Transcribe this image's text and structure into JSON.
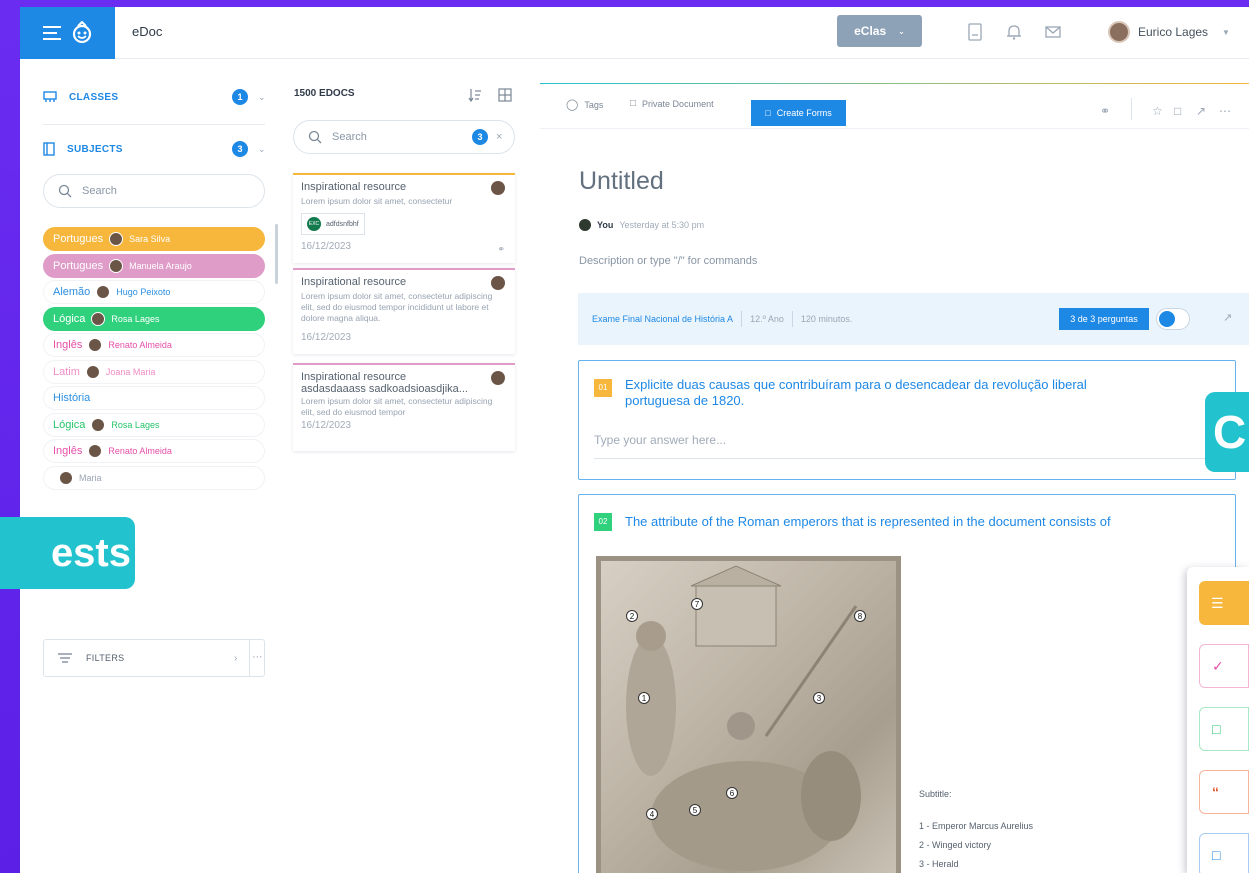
{
  "header": {
    "app_name": "eDoc",
    "env_button": "eClas",
    "user_name": "Eurico Lages"
  },
  "sidebar": {
    "classes_label": "CLASSES",
    "classes_count": "1",
    "subjects_label": "SUBJECTS",
    "subjects_count": "3",
    "search_placeholder": "Search",
    "subjects": [
      {
        "name": "Portugues",
        "teacher": "Sara Silva",
        "bg": "#f6b73c",
        "fg": "#ffffff",
        "tfg": "#ffffff"
      },
      {
        "name": "Portugues",
        "teacher": "Manuela Araujo",
        "bg": "#df9cc8",
        "fg": "#ffffff",
        "tfg": "#ffffff"
      },
      {
        "name": "Alemão",
        "teacher": "Hugo Peixoto",
        "bg": "#ffffff",
        "fg": "#2b8fe2",
        "tfg": "#2b8fe2"
      },
      {
        "name": "Lógica",
        "teacher": "Rosa Lages",
        "bg": "#2fd17d",
        "fg": "#ffffff",
        "tfg": "#ffffff"
      },
      {
        "name": "Inglês",
        "teacher": "Renato Almeida",
        "bg": "#ffffff",
        "fg": "#e64fa8",
        "tfg": "#e64fa8"
      },
      {
        "name": "Latim",
        "teacher": "Joana Maria",
        "bg": "#ffffff",
        "fg": "#f08cc4",
        "tfg": "#f08cc4"
      },
      {
        "name": "História",
        "teacher": "",
        "bg": "#ffffff",
        "fg": "#2b8fe2",
        "tfg": "#2b8fe2"
      },
      {
        "name": "Lógica",
        "teacher": "Rosa Lages",
        "bg": "#ffffff",
        "fg": "#27c46a",
        "tfg": "#27c46a"
      },
      {
        "name": "Inglês",
        "teacher": "Renato Almeida",
        "bg": "#ffffff",
        "fg": "#e64fa8",
        "tfg": "#e64fa8"
      },
      {
        "name": "",
        "teacher": "Maria",
        "bg": "#ffffff",
        "fg": "#9aa6b4",
        "tfg": "#9aa6b4"
      }
    ],
    "filters_label": "FILTERS"
  },
  "overlay": {
    "tests_text": "ests",
    "right_letter": "C"
  },
  "docs": {
    "title": "1500 EDOCS",
    "search_placeholder": "Search",
    "search_count": "3",
    "cards": [
      {
        "title": "Inspirational resource",
        "body": "Lorem ipsum dolor sit amet, consectetur",
        "tag": "adfdsnfbhf",
        "tag_initials": "EXC",
        "date": "16/12/2023",
        "accent": "#f6b73c"
      },
      {
        "title": "Inspirational resource",
        "body": "Lorem ipsum dolor sit amet, consectetur adipiscing elit, sed do eiusmod tempor incididunt ut labore et dolore magna aliqua.",
        "date": "16/12/2023",
        "accent": "#df9cc8"
      },
      {
        "title": "Inspirational resource",
        "subtitle": "asdasdaaass sadkoadsioasdjika...",
        "body": "Lorem ipsum dolor sit amet, consectetur adipiscing elit, sed do eiusmod tempor",
        "date": "16/12/2023",
        "accent": "#df9cc8"
      }
    ]
  },
  "editor": {
    "toolbar": {
      "tags": "Tags",
      "private": "Private Document",
      "create_forms": "Create Forms"
    },
    "title": "Untitled",
    "author": "You",
    "timestamp": "Yesterday at 5:30 pm",
    "description_placeholder": "Description or type \"/\" for commands",
    "exam": {
      "name": "Exame Final Nacional de História A",
      "year": "12.º Ano",
      "duration": "120 minutos.",
      "questions": "3 de 3 perguntas"
    },
    "questions": [
      {
        "num": "01",
        "text": "Explicite duas causas que contribuíram para o desencadear da revolução liberal portuguesa de 1820.",
        "answer_placeholder": "Type your answer here..."
      },
      {
        "num": "02",
        "text": "The attribute of the Roman emperors that is represented in the document consists of"
      }
    ],
    "legend": {
      "subtitle": "Subtitle:",
      "items": [
        "1 - Emperor Marcus Aurelius",
        "2 - Winged victory",
        "3 - Herald"
      ]
    },
    "markers": [
      "1",
      "2",
      "3",
      "4",
      "5",
      "6",
      "7",
      "8"
    ]
  },
  "colors": {
    "primary": "#1e88e5",
    "cyan": "#22c3cf",
    "purple_bg": "#5b1fe6"
  }
}
